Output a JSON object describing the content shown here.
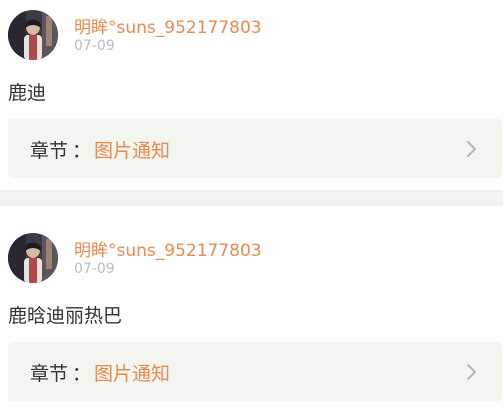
{
  "comments": [
    {
      "username": "明眸°suns_952177803",
      "date": "07-09",
      "text": "鹿迪",
      "chapter_label": "章节",
      "chapter_separator": "：",
      "chapter_title": "图片通知",
      "icons": {
        "avatar": "user-avatar",
        "arrow": "chevron-right-icon"
      }
    },
    {
      "username": "明眸°suns_952177803",
      "date": "07-09",
      "text": "鹿晗迪丽热巴",
      "chapter_label": "章节",
      "chapter_separator": "：",
      "chapter_title": "图片通知",
      "icons": {
        "avatar": "user-avatar",
        "arrow": "chevron-right-icon"
      }
    }
  ],
  "colors": {
    "username": "#e98a52",
    "chapter_title": "#e98a52",
    "chapter_box_bg": "#f2f6ee",
    "separator_bg": "#f2f2f2",
    "time": "#bdbdbd"
  }
}
